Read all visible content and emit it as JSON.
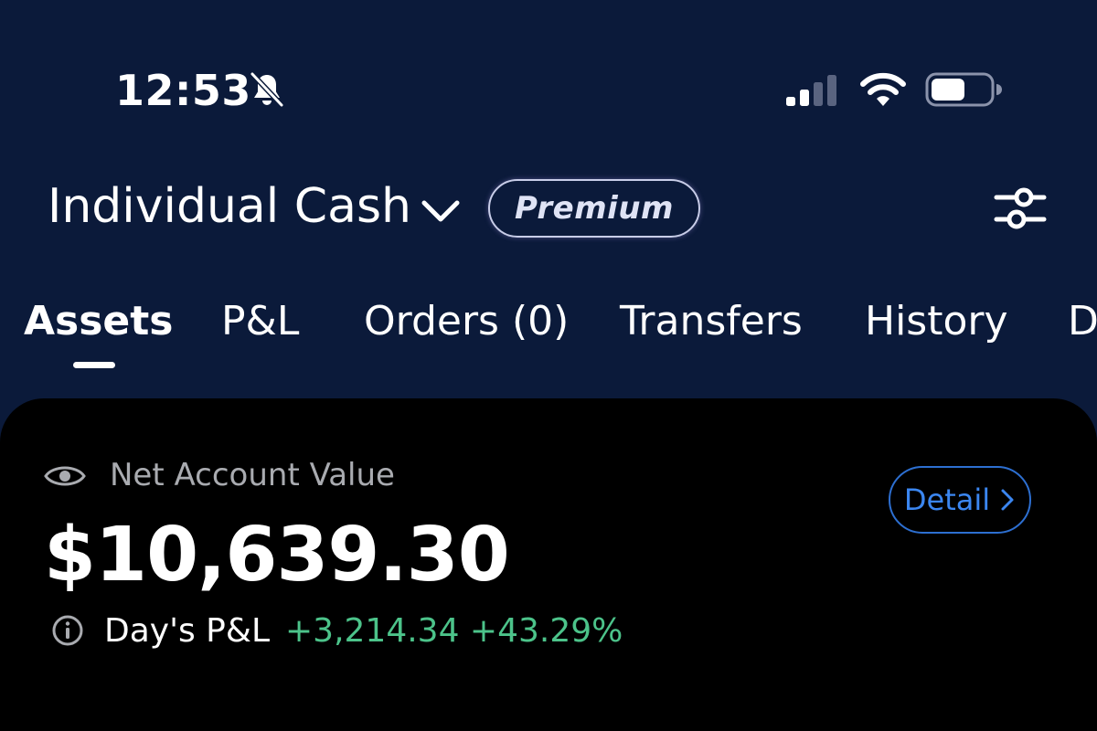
{
  "status_bar": {
    "time": "12:53",
    "icons": [
      "bell-off-icon",
      "cellular-signal-icon",
      "wifi-icon",
      "battery-icon"
    ]
  },
  "header": {
    "account_name": "Individual Cash",
    "badge": "Premium"
  },
  "tabs": [
    {
      "label": "Assets",
      "active": true
    },
    {
      "label": "P&L",
      "active": false
    },
    {
      "label": "Orders (0)",
      "active": false
    },
    {
      "label": "Transfers",
      "active": false
    },
    {
      "label": "History",
      "active": false
    },
    {
      "label": "D",
      "active": false
    }
  ],
  "summary": {
    "net_value_label": "Net Account Value",
    "net_value": "$10,639.30",
    "detail_button": "Detail",
    "days_pl_label": "Day's P&L",
    "days_pl_value": "+3,214.34 +43.29%"
  },
  "colors": {
    "background": "#0b1a3a",
    "card": "#000000",
    "positive": "#4cc38a",
    "accent_blue": "#3b86f0"
  }
}
